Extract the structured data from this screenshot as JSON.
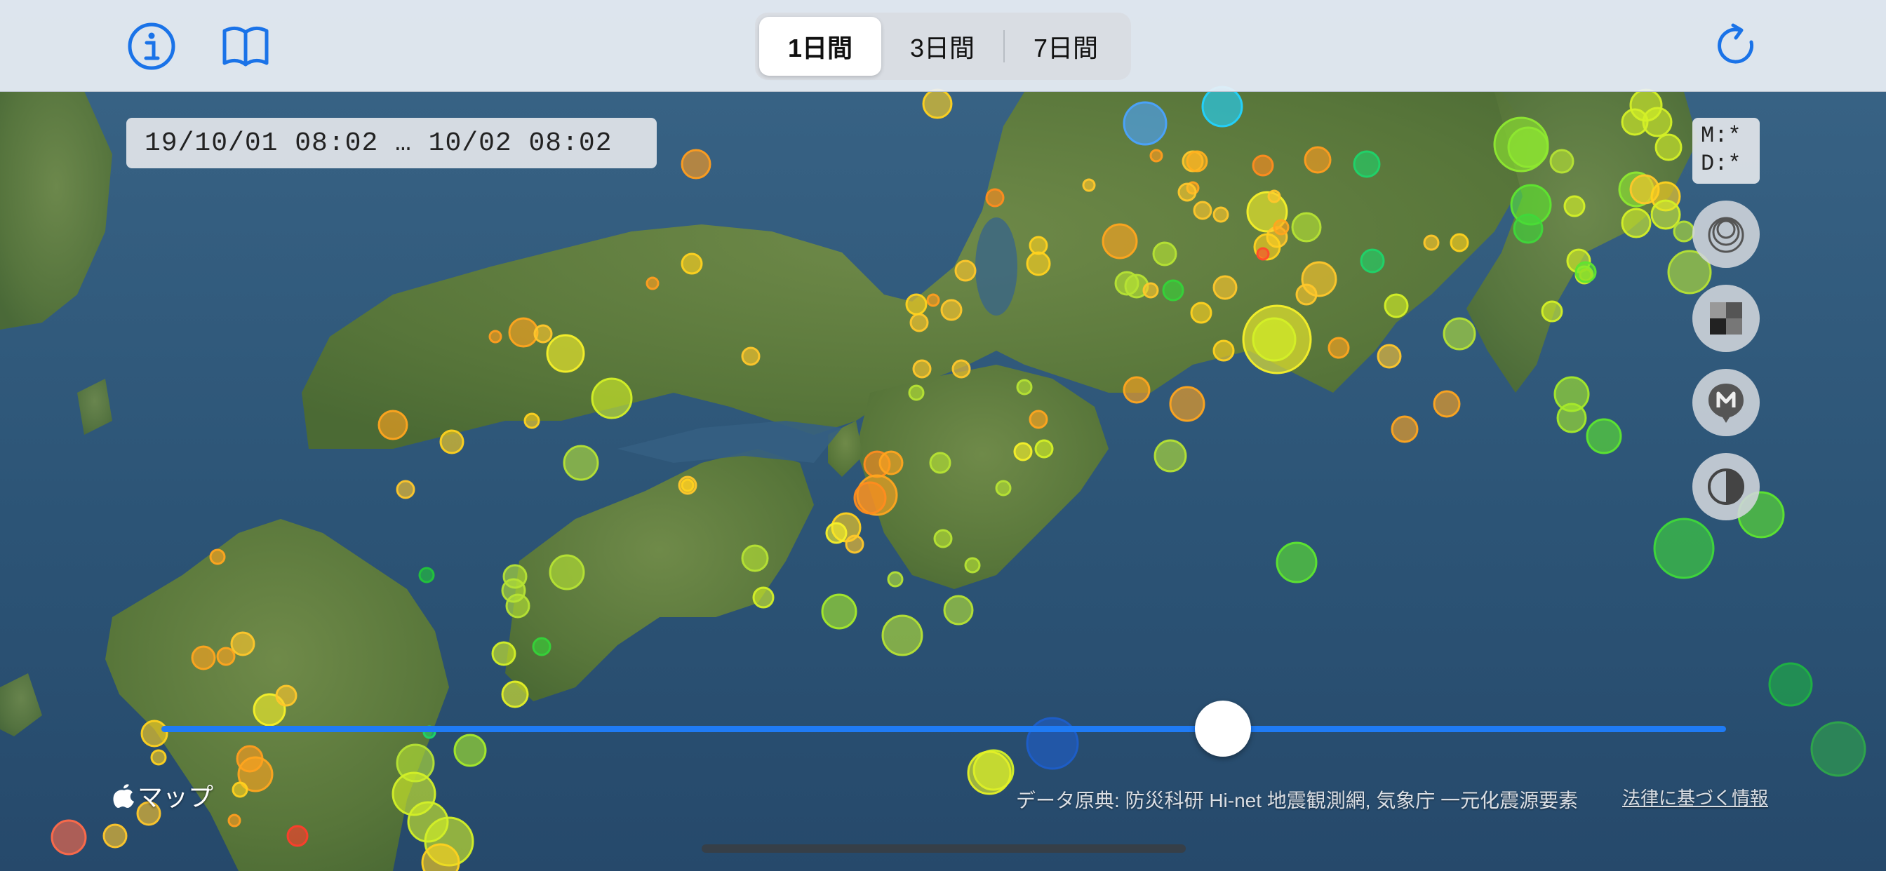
{
  "toolbar": {
    "info_icon": "info-icon",
    "book_icon": "book-icon",
    "refresh_icon": "refresh-icon",
    "accent_color": "#1a73e8",
    "periods": [
      {
        "label": "1日間",
        "active": true
      },
      {
        "label": "3日間",
        "active": false
      },
      {
        "label": "7日間",
        "active": false
      }
    ]
  },
  "date_range": "19/10/01 08:02 … 10/02 08:02",
  "filter": {
    "magnitude": "M:*",
    "depth": "D:*"
  },
  "side_buttons": [
    {
      "name": "depth-view-button",
      "icon": "concentric-circles-icon"
    },
    {
      "name": "map-style-button",
      "icon": "tiles-icon"
    },
    {
      "name": "magnitude-marker-button",
      "icon": "m-pin-icon"
    },
    {
      "name": "contrast-button",
      "icon": "half-circle-icon"
    }
  ],
  "timeline": {
    "position": 0.68,
    "track_color": "#1f7bf5"
  },
  "footer": {
    "maps_label": "マップ",
    "credit": "データ原典: 防災科研 Hi-net 地震観測網, 気象庁 一元化震源要素",
    "legal_link": "法律に基づく情報"
  },
  "map": {
    "type": "satellite",
    "region": "western-central Japan",
    "land_color": "#5d7a3e",
    "sea_color": "#2d5577"
  }
}
